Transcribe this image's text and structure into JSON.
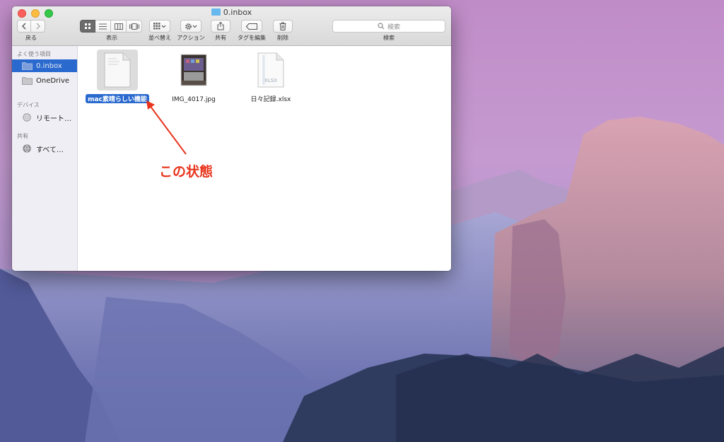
{
  "window": {
    "title": "0.inbox",
    "folder_icon_color": "#66b8ee"
  },
  "toolbar": {
    "back_label": "戻る",
    "view_label": "表示",
    "arrange_label": "並べ替え",
    "action_label": "アクション",
    "share_label": "共有",
    "tags_label": "タグを編集",
    "delete_label": "削除",
    "search_label": "検索",
    "search_placeholder": "検索",
    "view_mode": "icon"
  },
  "sidebar": {
    "sections": [
      {
        "heading": "よく使う項目",
        "items": [
          {
            "label": "0.inbox",
            "icon": "folder-icon",
            "selected": true
          },
          {
            "label": "OneDrive",
            "icon": "folder-icon",
            "selected": false
          }
        ]
      },
      {
        "heading": "デバイス",
        "items": [
          {
            "label": "リモート…",
            "icon": "disc-icon",
            "selected": false
          }
        ]
      },
      {
        "heading": "共有",
        "items": [
          {
            "label": "すべて…",
            "icon": "globe-icon",
            "selected": false
          }
        ]
      }
    ]
  },
  "files": [
    {
      "name": "mac素晴らしい機能",
      "icon": "document-icon",
      "selected": true
    },
    {
      "name": "IMG_4017.jpg",
      "icon": "image-thumbnail-icon",
      "selected": false
    },
    {
      "name": "日々記録.xlsx",
      "icon": "xlsx-document-icon",
      "badge": "XLSX",
      "selected": false
    }
  ],
  "annotation": {
    "text": "この状態",
    "color": "#e8341c"
  },
  "colors": {
    "selection": "#2a6acf",
    "sidebar_bg": "#efeef4"
  }
}
